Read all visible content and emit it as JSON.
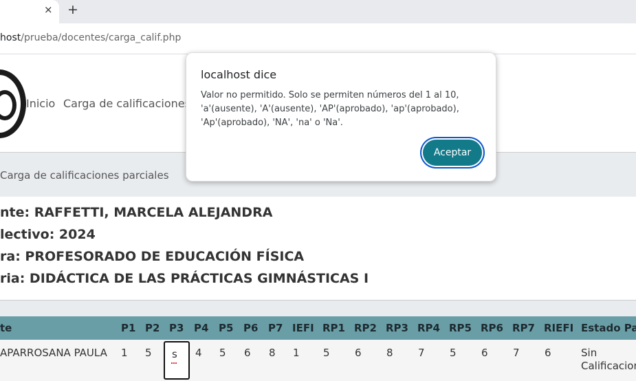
{
  "browser": {
    "new_tab_label": "+",
    "close_tab_label": "×",
    "url_host": "host",
    "url_path": "/prueba/docentes/carga_calif.php"
  },
  "nav": {
    "links": [
      "Inicio",
      "Carga de calificaciones"
    ]
  },
  "breadcrumb": "Carga de calificaciones parciales",
  "info": {
    "docente": "nte: RAFFETTI, MARCELA ALEJANDRA",
    "ciclo": "lectivo: 2024",
    "carrera": "ra: PROFESORADO DE EDUCACIÓN FÍSICA",
    "materia": "ria: DIDÁCTICA DE LAS PRÁCTICAS GIMNÁSTICAS I"
  },
  "table": {
    "headers": [
      "te",
      "P1",
      "P2",
      "P3",
      "P4",
      "P5",
      "P6",
      "P7",
      "IEFI",
      "RP1",
      "RP2",
      "RP3",
      "RP4",
      "RP5",
      "RP6",
      "RP7",
      "RIEFI",
      "Estado Par"
    ],
    "row": {
      "alumno": "APARROSANA PAULA",
      "cells": [
        "1",
        "5",
        "s",
        "4",
        "5",
        "6",
        "8",
        "1",
        "5",
        "6",
        "8",
        "7",
        "5",
        "6",
        "7",
        "6"
      ],
      "estado_line1": "Sin",
      "estado_line2": "Calificacion"
    }
  },
  "dialog": {
    "title": "localhost dice",
    "message": "Valor no permitido. Solo se permiten números del 1 al 10, 'a'(ausente), 'A'(ausente), 'AP'(aprobado), 'ap'(aprobado), 'Ap'(aprobado), 'NA', 'na' o 'Na'.",
    "accept_label": "Aceptar"
  },
  "colors": {
    "table_header": "#6a9ea7",
    "accept_button": "#137a8a",
    "focus_ring": "#0b57d0"
  }
}
